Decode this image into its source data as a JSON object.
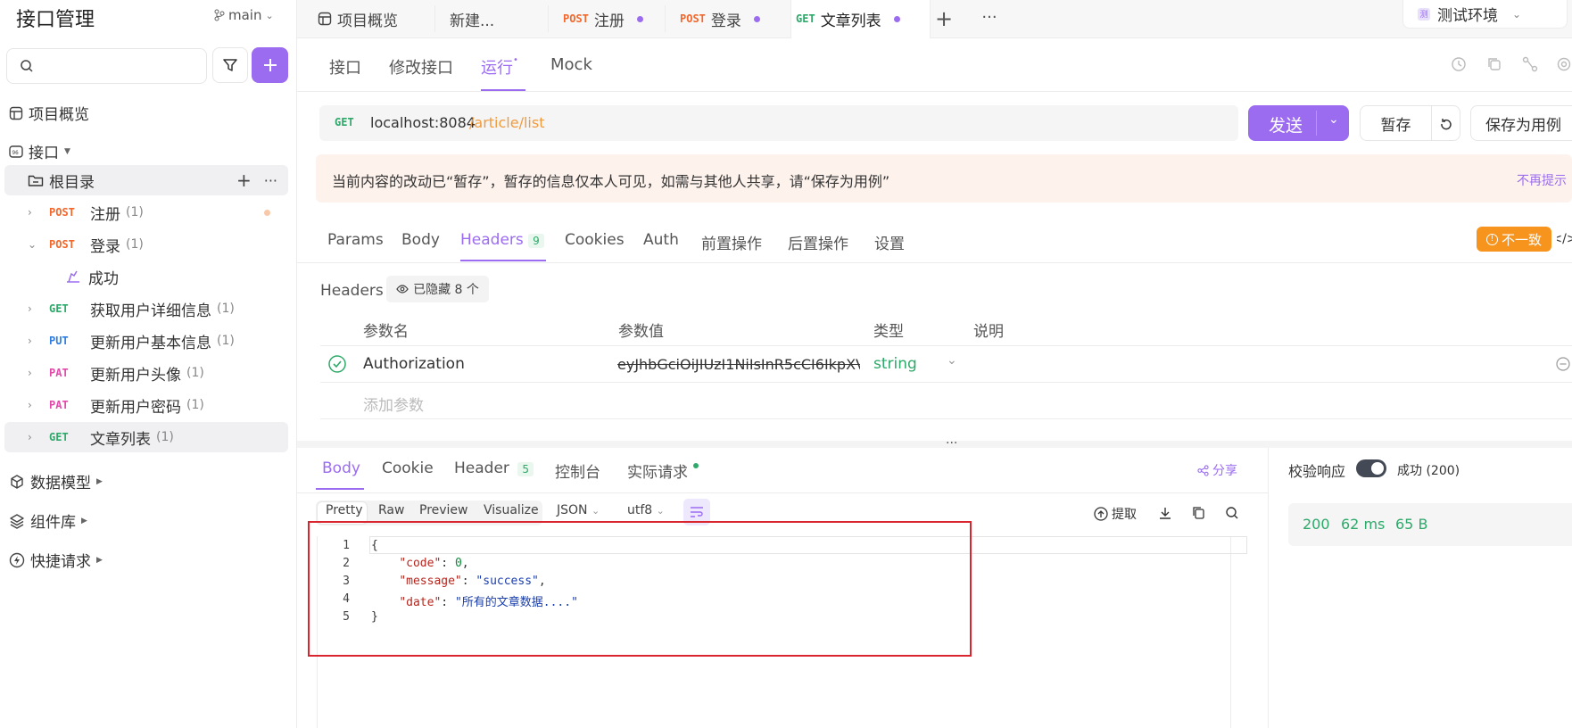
{
  "sidebar": {
    "title": "接口管理",
    "branch": "main",
    "search_placeholder": "",
    "nav": {
      "overview": "项目概览",
      "apis": "接口",
      "data_models": "数据模型",
      "components": "组件库",
      "quick_requests": "快捷请求"
    },
    "root": "根目录",
    "items": [
      {
        "method": "POST",
        "name": "注册",
        "count": "(1)"
      },
      {
        "method": "POST",
        "name": "登录",
        "count": "(1)"
      },
      {
        "method": "",
        "name": "成功",
        "count": ""
      },
      {
        "method": "GET",
        "name": "获取用户详细信息",
        "count": "(1)"
      },
      {
        "method": "PUT",
        "name": "更新用户基本信息",
        "count": "(1)"
      },
      {
        "method": "PAT",
        "name": "更新用户头像",
        "count": "(1)"
      },
      {
        "method": "PAT",
        "name": "更新用户密码",
        "count": "(1)"
      },
      {
        "method": "GET",
        "name": "文章列表",
        "count": "(1)"
      }
    ]
  },
  "tabs": [
    {
      "method": "",
      "label": "项目概览"
    },
    {
      "method": "",
      "label": "新建..."
    },
    {
      "method": "POST",
      "label": "注册"
    },
    {
      "method": "POST",
      "label": "登录"
    },
    {
      "method": "GET",
      "label": "文章列表"
    }
  ],
  "env": "测试环境",
  "subtabs": {
    "api": "接口",
    "edit": "修改接口",
    "run": "运行",
    "mock": "Mock"
  },
  "request": {
    "method": "GET",
    "host": "localhost:8084",
    "path": "/article/list",
    "send": "发送",
    "save_temp": "暂存",
    "save_case": "保存为用例"
  },
  "banner": {
    "text": "当前内容的改动已“暂存”，暂存的信息仅本人可见，如需与其他人共享，请“保存为用例”",
    "dismiss": "不再提示"
  },
  "params_tabs": {
    "params": "Params",
    "body": "Body",
    "headers": "Headers",
    "headers_count": "9",
    "cookies": "Cookies",
    "auth": "Auth",
    "pre": "前置操作",
    "post": "后置操作",
    "settings": "设置",
    "mismatch": "不一致"
  },
  "headers": {
    "label": "Headers",
    "hidden": "已隐藏 8 个",
    "col_name": "参数名",
    "col_value": "参数值",
    "col_type": "类型",
    "col_desc": "说明",
    "row": {
      "name": "Authorization",
      "value": "eyJhbGciOiJIUzI1NiIsInR5cCI6IkpXV",
      "type": "string"
    },
    "add_placeholder": "添加参数"
  },
  "response": {
    "tabs": {
      "body": "Body",
      "cookie": "Cookie",
      "header": "Header",
      "header_count": "5",
      "console": "控制台",
      "actual": "实际请求"
    },
    "share": "分享",
    "formats": {
      "pretty": "Pretty",
      "raw": "Raw",
      "preview": "Preview",
      "visualize": "Visualize",
      "json": "JSON",
      "utf8": "utf8"
    },
    "extract": "提取",
    "code_lines": [
      "{",
      "    \"code\": 0,",
      "    \"message\": \"success\",",
      "    \"date\": \"所有的文章数据....\"",
      "}"
    ],
    "verify_label": "校验响应",
    "verify_status": "成功 (200)",
    "status": "200",
    "time": "62 ms",
    "size": "65 B"
  },
  "colors": {
    "accent": "#9b6cf0",
    "post": "#f2672b",
    "get": "#2ea96a",
    "put": "#2f7de1",
    "pat": "#e04aa8"
  }
}
